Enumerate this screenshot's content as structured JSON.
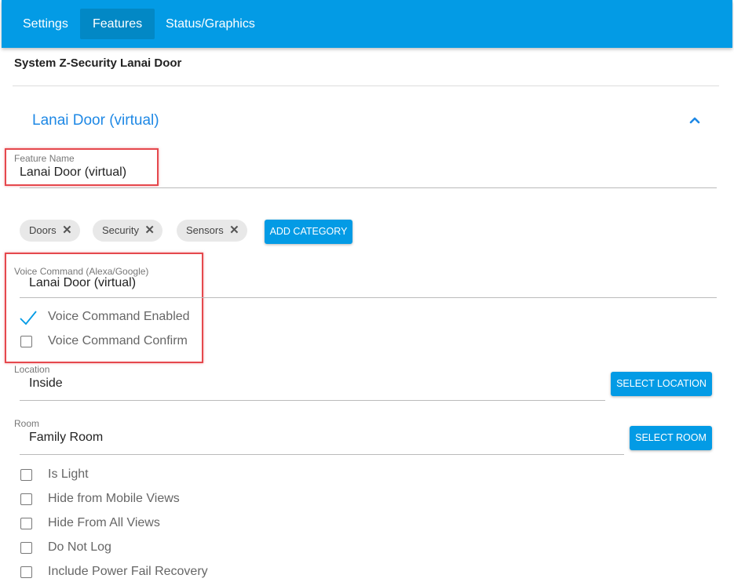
{
  "tabs": [
    {
      "label": "Settings"
    },
    {
      "label": "Features"
    },
    {
      "label": "Status/Graphics"
    }
  ],
  "header": {
    "system_title": "System Z-Security Lanai Door"
  },
  "section": {
    "title": "Lanai Door (virtual)",
    "toggle_icon": "chevron-up-icon"
  },
  "feature_name": {
    "label": "Feature Name",
    "value": "Lanai Door (virtual)"
  },
  "categories": {
    "chips": [
      {
        "label": "Doors"
      },
      {
        "label": "Security"
      },
      {
        "label": "Sensors"
      }
    ],
    "add_label": "ADD CATEGORY"
  },
  "voice": {
    "label": "Voice Command (Alexa/Google)",
    "value": "Lanai Door (virtual)",
    "enabled_label": "Voice Command Enabled",
    "enabled_checked": true,
    "confirm_label": "Voice Command Confirm",
    "confirm_checked": false
  },
  "location": {
    "label": "Location",
    "value": "Inside",
    "button": "SELECT LOCATION"
  },
  "room": {
    "label": "Room",
    "value": "Family Room",
    "button": "SELECT ROOM"
  },
  "options": [
    {
      "label": "Is Light",
      "checked": false
    },
    {
      "label": "Hide from Mobile Views",
      "checked": false
    },
    {
      "label": "Hide From All Views",
      "checked": false
    },
    {
      "label": "Do Not Log",
      "checked": false
    },
    {
      "label": "Include Power Fail Recovery",
      "checked": false
    }
  ],
  "colors": {
    "primary": "#039be5",
    "accent_text": "#1e88e5",
    "highlight": "#e5484d"
  }
}
